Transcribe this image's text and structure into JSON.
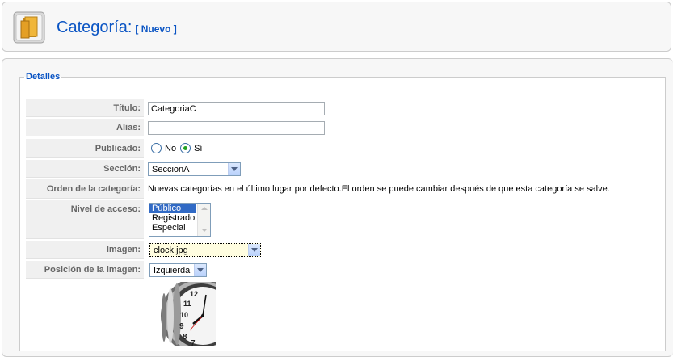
{
  "header": {
    "title": "Categoría:",
    "status": "[ Nuevo ]",
    "icon": "category-folder-icon"
  },
  "form": {
    "legend": "Detalles",
    "titulo": {
      "label": "Título:",
      "value": "CategoriaC"
    },
    "alias": {
      "label": "Alias:",
      "value": ""
    },
    "publicado": {
      "label": "Publicado:",
      "option_no": "No",
      "option_si": "Sí",
      "selected": "Sí"
    },
    "seccion": {
      "label": "Sección:",
      "value": "SeccionA"
    },
    "orden": {
      "label": "Orden de la categoría:",
      "text": "Nuevas categorías en el último lugar por defecto.El orden se puede cambiar después de que esta categoría se salve."
    },
    "acceso": {
      "label": "Nivel de acceso:",
      "options": [
        "Público",
        "Registrado",
        "Especial"
      ],
      "selected": "Público"
    },
    "imagen": {
      "label": "Imagen:",
      "value": "clock.jpg"
    },
    "posicion": {
      "label": "Posición de la imagen:",
      "value": "Izquierda"
    },
    "preview_icon": "clock-image"
  }
}
